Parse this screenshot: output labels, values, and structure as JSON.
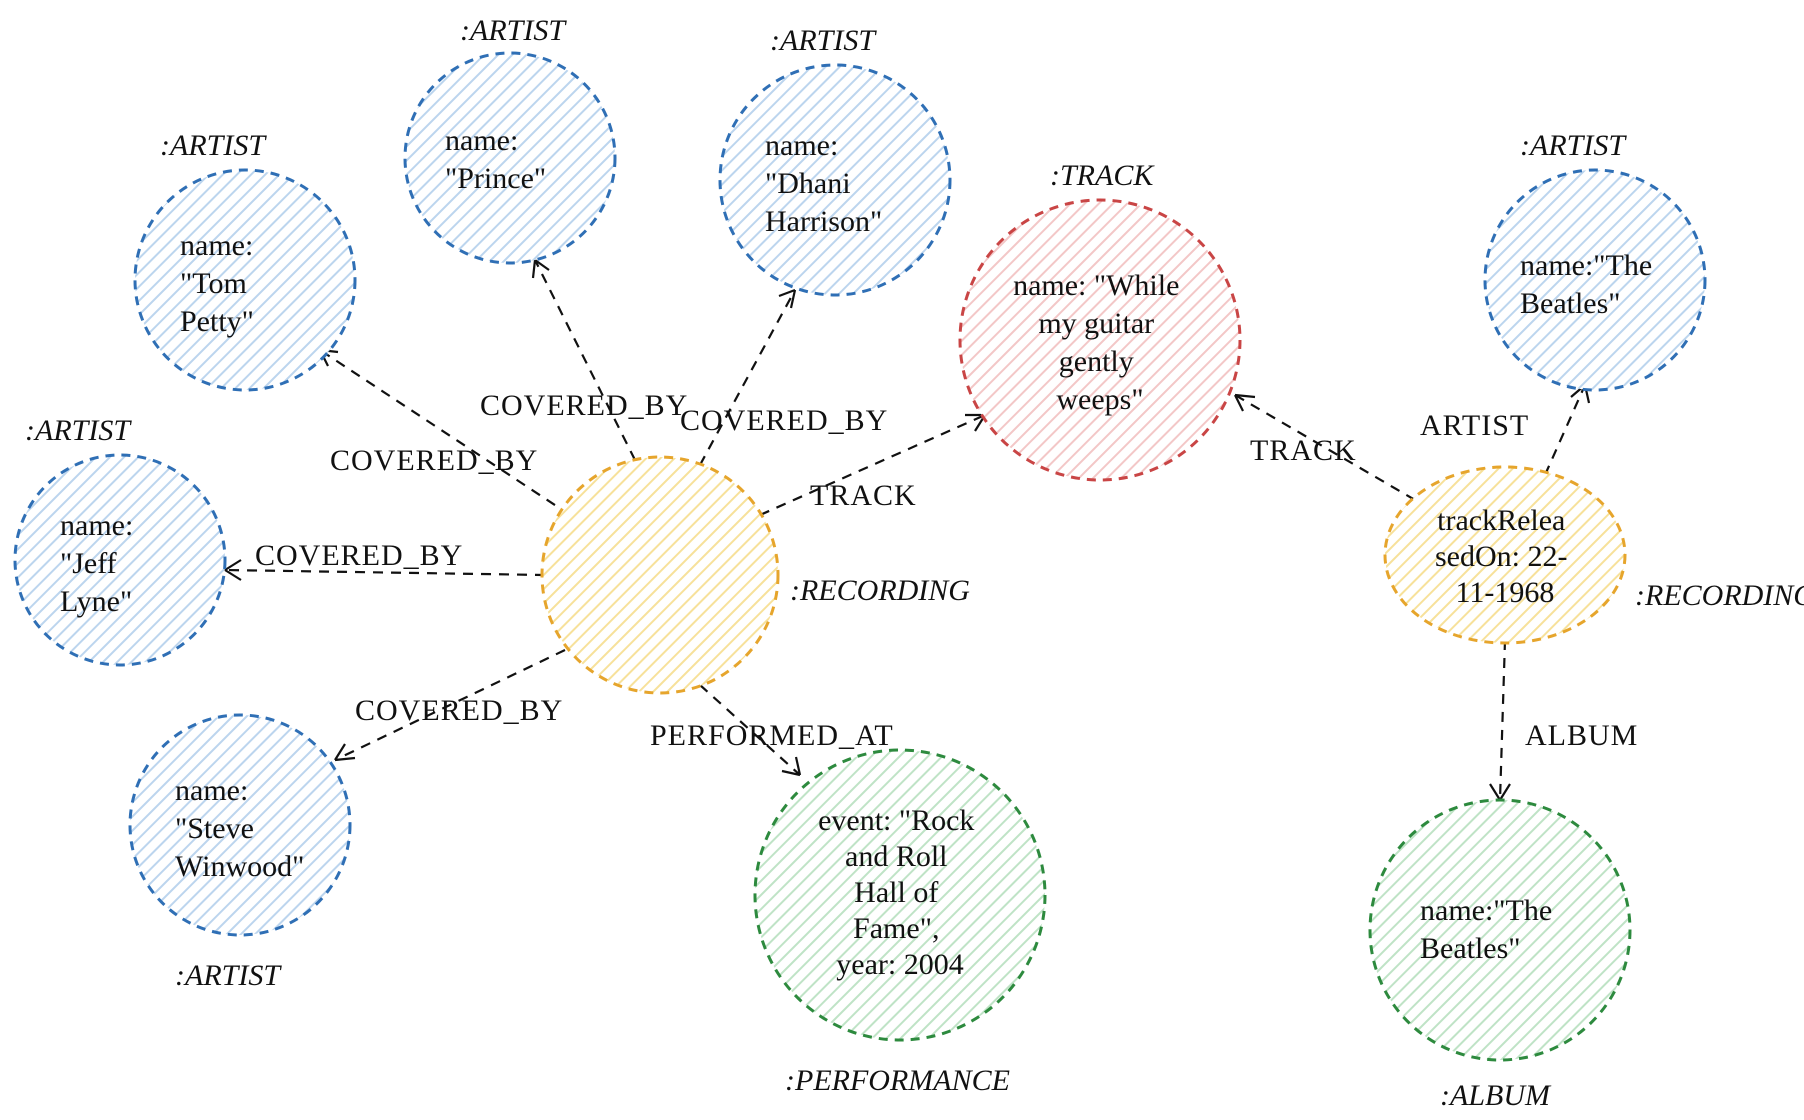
{
  "colors": {
    "blue": "#2f6fb5",
    "blueFill": "#dceaf7",
    "orange": "#e6a52c",
    "orangeFill": "#fcf0c2",
    "red": "#c94545",
    "redFill": "#fbe2e2",
    "green": "#2d8a3e",
    "greenFill": "#e4f2e6"
  },
  "nodes": {
    "artist_tom": {
      "typeLabel": ":ARTIST",
      "props": "name:\n\"Tom\nPetty\""
    },
    "artist_prince": {
      "typeLabel": ":ARTIST",
      "props": "name:\n\"Prince\""
    },
    "artist_dhani": {
      "typeLabel": ":ARTIST",
      "props": "name:\n\"Dhani\nHarrison\""
    },
    "artist_jeff": {
      "typeLabel": ":ARTIST",
      "props": "name:\n\"Jeff\nLyne\""
    },
    "artist_steve": {
      "typeLabel": ":ARTIST",
      "props": "name:\n\"Steve\nWinwood\""
    },
    "artist_beatles": {
      "typeLabel": ":ARTIST",
      "props": "name:\"The\nBeatles\""
    },
    "track": {
      "typeLabel": ":TRACK",
      "props": "name: \"While\nmy guitar\ngently\nweeps\""
    },
    "recording_left": {
      "typeLabel": ":RECORDING",
      "props": ""
    },
    "recording_right": {
      "typeLabel": ":RECORDING",
      "props": "trackRelea\nsedOn: 22-\n11-1968"
    },
    "performance": {
      "typeLabel": ":PERFORMANCE",
      "props": "event: \"Rock\nand Roll\nHall of\nFame\",\nyear: 2004"
    },
    "album": {
      "typeLabel": ":ALBUM",
      "props": "name:\"The\nBeatles\""
    }
  },
  "edges": {
    "cov_tom": "COVERED_BY",
    "cov_prince": "COVERED_BY",
    "cov_dhani": "COVERED_BY",
    "cov_jeff": "COVERED_BY",
    "cov_steve": "COVERED_BY",
    "track_edge": "TRACK",
    "performed": "PERFORMED_AT",
    "track_edge2": "TRACK",
    "artist_edge": "ARTIST",
    "album_edge": "ALBUM"
  }
}
